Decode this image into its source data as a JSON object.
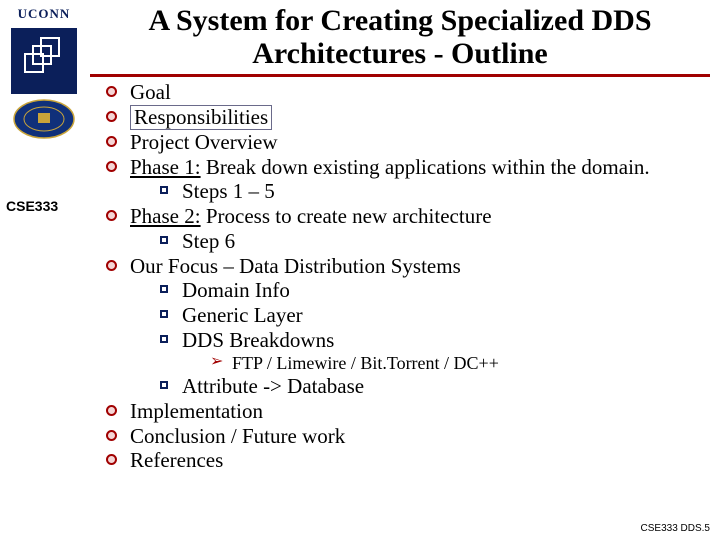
{
  "header": {
    "title_line1": "A System for Creating Specialized DDS",
    "title_line2": "Architectures - Outline"
  },
  "sidebar": {
    "uconn": "UCONN",
    "course": "CSE333"
  },
  "outline": {
    "goal": "Goal",
    "responsibilities": "Responsibilities",
    "project_overview": "Project Overview",
    "phase1_label": "Phase 1:",
    "phase1_rest": " Break down existing applications within the domain.",
    "phase1_sub": "Steps 1 – 5",
    "phase2_label": "Phase 2:",
    "phase2_rest": " Process to create new architecture",
    "phase2_sub": "Step 6",
    "focus": "Our Focus – Data Distribution Systems",
    "focus_sub1": "Domain Info",
    "focus_sub2": "Generic Layer",
    "focus_sub3": "DDS Breakdowns",
    "focus_sub3_sub": "FTP / Limewire / Bit.Torrent / DC++",
    "focus_sub4": "Attribute -> Database",
    "implementation": "Implementation",
    "conclusion": "Conclusion / Future work",
    "references": "References"
  },
  "footer": {
    "text": "CSE333 DDS.5"
  }
}
